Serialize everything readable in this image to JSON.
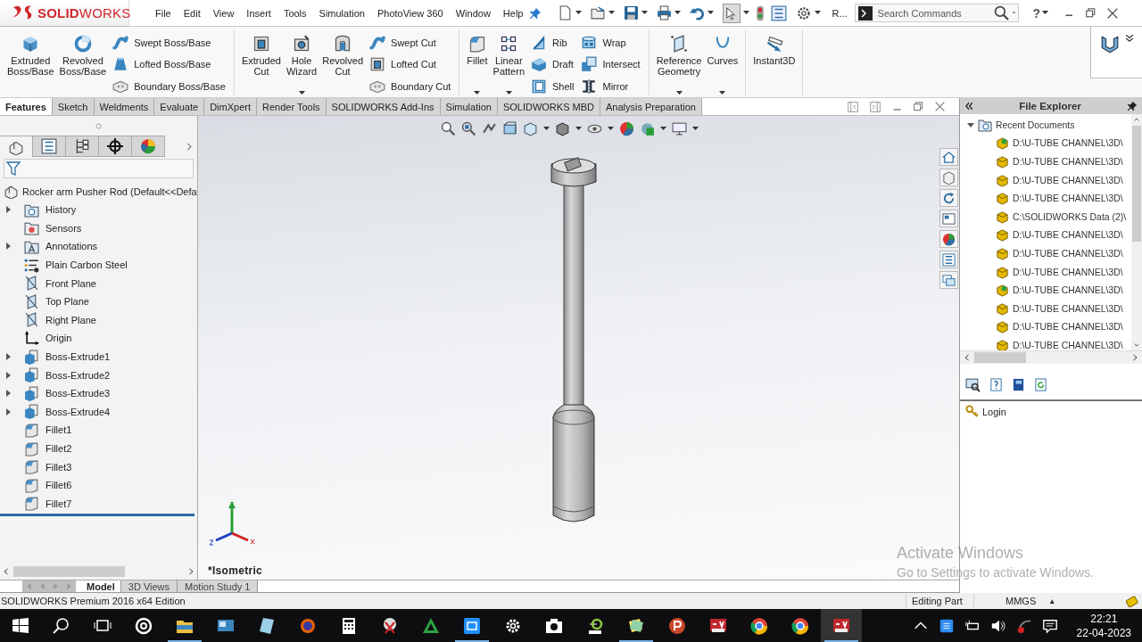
{
  "title_bar": {
    "logo": "**SOLID**WORKS",
    "menu": [
      "File",
      "Edit",
      "View",
      "Insert",
      "Tools",
      "Simulation",
      "PhotoView 360",
      "Window",
      "Help"
    ],
    "overflow": "R...",
    "search": {
      "placeholder": "Search Commands"
    },
    "help": "?"
  },
  "ribbon": {
    "groups": [
      {
        "columns": [
          {
            "kind": "large",
            "label": "Extruded\nBoss/Base"
          },
          {
            "kind": "large",
            "label": "Revolved\nBoss/Base"
          },
          {
            "kind": "stack",
            "items": [
              "Swept Boss/Base",
              "Lofted Boss/Base",
              "Boundary Boss/Base"
            ]
          }
        ]
      },
      {
        "columns": [
          {
            "kind": "large",
            "label": "Extruded\nCut"
          },
          {
            "kind": "large",
            "label": "Hole\nWizard",
            "dropdown": true
          },
          {
            "kind": "large",
            "label": "Revolved\nCut"
          },
          {
            "kind": "stack",
            "items": [
              "Swept Cut",
              "Lofted Cut",
              "Boundary Cut"
            ]
          }
        ]
      },
      {
        "columns": [
          {
            "kind": "large",
            "label": "Fillet",
            "dropdown": true
          },
          {
            "kind": "large",
            "label": "Linear\nPattern",
            "dropdown": true
          },
          {
            "kind": "stack",
            "items": [
              "Rib",
              "Draft",
              "Shell"
            ]
          },
          {
            "kind": "stack",
            "items": [
              "Wrap",
              "Intersect",
              "Mirror"
            ]
          }
        ]
      },
      {
        "columns": [
          {
            "kind": "large",
            "label": "Reference\nGeometry",
            "dropdown": true
          },
          {
            "kind": "large",
            "label": "Curves",
            "dropdown": true
          }
        ]
      },
      {
        "columns": [
          {
            "kind": "large",
            "label": "Instant3D"
          }
        ]
      }
    ]
  },
  "command_tabs": [
    {
      "label": "Features",
      "selected": true
    },
    {
      "label": "Sketch",
      "selected": false
    },
    {
      "label": "Weldments",
      "selected": false
    },
    {
      "label": "Evaluate",
      "selected": false
    },
    {
      "label": "DimXpert",
      "selected": false
    },
    {
      "label": "Render Tools",
      "selected": false
    },
    {
      "label": "SOLIDWORKS Add-Ins",
      "selected": false
    },
    {
      "label": "Simulation",
      "selected": false
    },
    {
      "label": "SOLIDWORKS MBD",
      "selected": false
    },
    {
      "label": "Analysis Preparation",
      "selected": false
    }
  ],
  "feature_tree": {
    "panel_tabs": [
      {
        "selected": true
      },
      {
        "selected": false
      },
      {
        "selected": false
      },
      {
        "selected": false
      },
      {
        "selected": false
      }
    ],
    "root": "Rocker arm Pusher Rod  (Default<<Defa",
    "items": [
      {
        "label": "History",
        "kind": "history",
        "expanded": false
      },
      {
        "label": "Sensors",
        "kind": "sensors"
      },
      {
        "label": "Annotations",
        "kind": "annotations",
        "expanded": false
      },
      {
        "label": "Plain Carbon Steel",
        "kind": "material"
      },
      {
        "label": "Front Plane",
        "kind": "plane"
      },
      {
        "label": "Top Plane",
        "kind": "plane"
      },
      {
        "label": "Right Plane",
        "kind": "plane"
      },
      {
        "label": "Origin",
        "kind": "origin"
      },
      {
        "label": "Boss-Extrude1",
        "kind": "extrude",
        "expanded": false
      },
      {
        "label": "Boss-Extrude2",
        "kind": "extrude",
        "expanded": false
      },
      {
        "label": "Boss-Extrude3",
        "kind": "extrude",
        "expanded": false
      },
      {
        "label": "Boss-Extrude4",
        "kind": "extrude",
        "expanded": false
      },
      {
        "label": "Fillet1",
        "kind": "fillet"
      },
      {
        "label": "Fillet2",
        "kind": "fillet"
      },
      {
        "label": "Fillet3",
        "kind": "fillet"
      },
      {
        "label": "Fillet6",
        "kind": "fillet"
      },
      {
        "label": "Fillet7",
        "kind": "fillet"
      }
    ]
  },
  "viewport": {
    "view_label": "*Isometric"
  },
  "file_explorer": {
    "title": "File Explorer",
    "root": {
      "label": "Recent Documents",
      "expanded": true,
      "children": [
        {
          "label": "D:\\U-TUBE CHANNEL\\3D\\",
          "kind": "new"
        },
        {
          "label": "D:\\U-TUBE CHANNEL\\3D\\",
          "kind": "assembly"
        },
        {
          "label": "D:\\U-TUBE CHANNEL\\3D\\",
          "kind": "assembly"
        },
        {
          "label": "D:\\U-TUBE CHANNEL\\3D\\",
          "kind": "assembly"
        },
        {
          "label": "C:\\SOLIDWORKS Data (2)\\",
          "kind": "assembly"
        },
        {
          "label": "D:\\U-TUBE CHANNEL\\3D\\",
          "kind": "assembly"
        },
        {
          "label": "D:\\U-TUBE CHANNEL\\3D\\",
          "kind": "assembly"
        },
        {
          "label": "D:\\U-TUBE CHANNEL\\3D\\",
          "kind": "assembly"
        },
        {
          "label": "D:\\U-TUBE CHANNEL\\3D\\",
          "kind": "new"
        },
        {
          "label": "D:\\U-TUBE CHANNEL\\3D\\",
          "kind": "assembly"
        },
        {
          "label": "D:\\U-TUBE CHANNEL\\3D\\",
          "kind": "assembly"
        },
        {
          "label": "D:\\U-TUBE CHANNEL\\3D\\",
          "kind": "assembly"
        }
      ]
    },
    "login": "Login"
  },
  "bottom_tabs": [
    {
      "label": "Model",
      "selected": true
    },
    {
      "label": "3D Views",
      "selected": false
    },
    {
      "label": "Motion Study 1",
      "selected": false
    }
  ],
  "status_bar": {
    "edition": "SOLIDWORKS Premium 2016 x64 Edition",
    "mode": "Editing Part",
    "units": "MMGS",
    "units_caret": "▲"
  },
  "taskbar": {
    "time": "22:21",
    "date": "22-04-2023"
  },
  "activation_notice": {
    "title": "Activate Windows",
    "subtitle": "Go to Settings to activate Windows."
  }
}
